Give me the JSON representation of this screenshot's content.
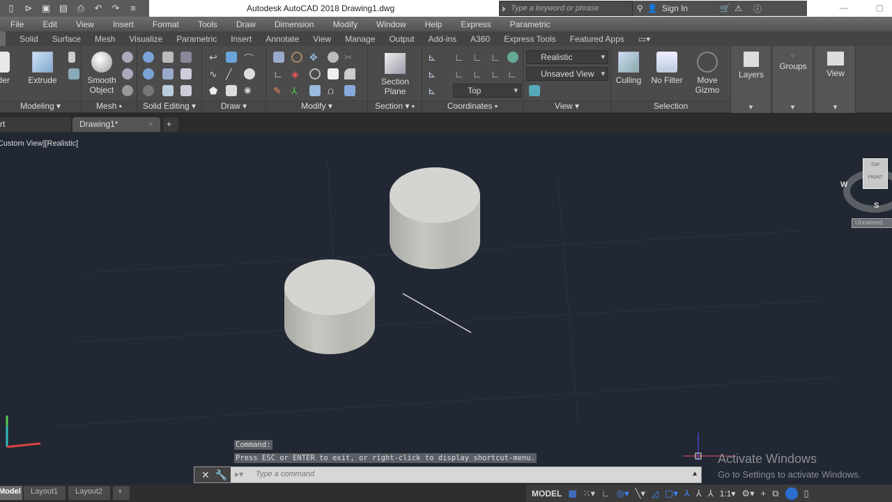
{
  "titlebar": {
    "title": "Autodesk AutoCAD 2018    Drawing1.dwg",
    "search_placeholder": "Type a keyword or phrase",
    "sign_in": "Sign In",
    "qat_icons": [
      "new-icon",
      "open-icon",
      "save-icon",
      "saveas-icon",
      "print-icon",
      "undo-icon",
      "redo-icon",
      "customize-icon"
    ]
  },
  "menubar": [
    "File",
    "Edit",
    "View",
    "Insert",
    "Format",
    "Tools",
    "Draw",
    "Dimension",
    "Modify",
    "Window",
    "Help",
    "Express",
    "Parametric"
  ],
  "ribbon_tabs": [
    "Solid",
    "Surface",
    "Mesh",
    "Visualize",
    "Parametric",
    "Insert",
    "Annotate",
    "View",
    "Manage",
    "Output",
    "Add-ins",
    "A360",
    "Express Tools",
    "Featured Apps"
  ],
  "ribbon": {
    "modeling": {
      "label": "Modeling",
      "cylinder": "Cylinder",
      "extrude": "Extrude"
    },
    "mesh": {
      "label": "Mesh",
      "smooth_object": "Smooth Object"
    },
    "solid_editing": {
      "label": "Solid Editing"
    },
    "draw": {
      "label": "Draw"
    },
    "modify": {
      "label": "Modify"
    },
    "section": {
      "label": "Section",
      "section_plane": "Section Plane"
    },
    "coordinates": {
      "label": "Coordinates",
      "ucs_view": "Top"
    },
    "view": {
      "label": "View",
      "visual_style": "Realistic",
      "named_view": "Unsaved View"
    },
    "selection": {
      "label": "Selection",
      "culling": "Culling",
      "no_filter": "No Filter",
      "move_gizmo": "Move Gizmo"
    },
    "layers": "Layers",
    "groups": "Groups",
    "view_btn": "View"
  },
  "doc_tabs": {
    "start": "Start",
    "drawing": "Drawing1*"
  },
  "viewport": {
    "label": "[-][Custom View][Realistic]",
    "viewcube": {
      "top": "TOP",
      "front": "FRONT",
      "west": "W",
      "south": "S",
      "ucs": "Unnamed"
    }
  },
  "command": {
    "history": [
      "Command:",
      "Press ESC or ENTER to exit, or right-click to display shortcut-menu."
    ],
    "placeholder": "Type a command"
  },
  "watermark": {
    "line1": "Activate Windows",
    "line2": "Go to Settings to activate Windows."
  },
  "layout_tabs": [
    "Model",
    "Layout1",
    "Layout2"
  ],
  "statusbar": {
    "model": "MODEL",
    "scale": "1:1"
  }
}
